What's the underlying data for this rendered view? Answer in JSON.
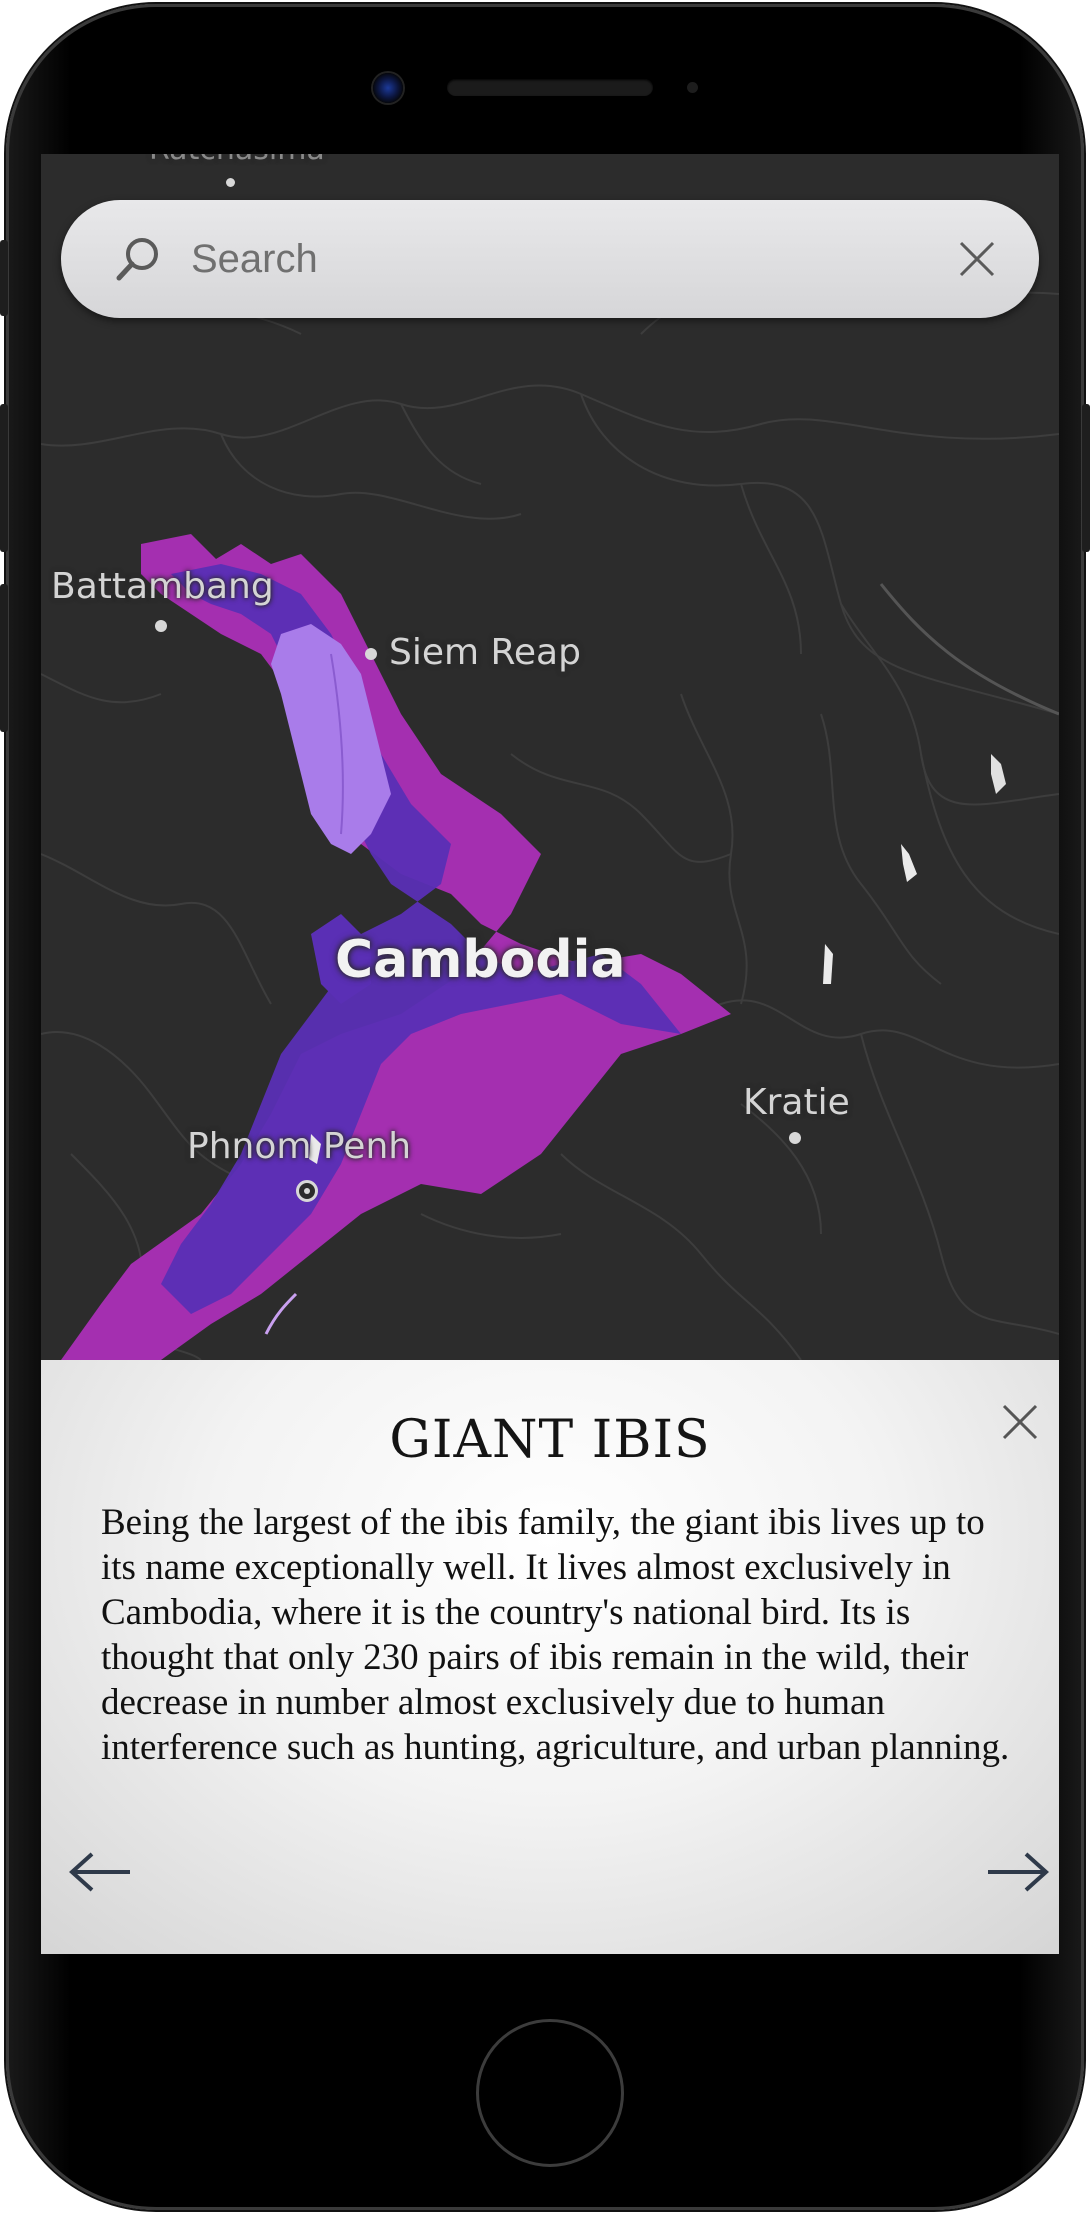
{
  "search": {
    "placeholder": "Search",
    "value": ""
  },
  "map": {
    "labels": {
      "top_cutoff": "Ratchasima",
      "battambang": "Battambang",
      "siem_reap": "Siem Reap",
      "country": "Cambodia",
      "kratie": "Kratie",
      "phnom_penh": "Phnom Penh"
    },
    "colors": {
      "background": "#2c2c2c",
      "range_purple": "#5a2fb5",
      "range_magenta": "#a42fb0",
      "range_lavender": "#a97cea"
    }
  },
  "info_panel": {
    "title": "GIANT IBIS",
    "body": "Being the largest of the ibis family, the giant ibis lives up to its name exceptionally well. It lives almost exclusively in Cambodia, where it is the country's national bird. Its is thought that only 230 pairs of ibis remain in the wild, their decrease in number almost exclusively due to human interference such as hunting, agriculture, and urban planning.",
    "icons": {
      "close": "close-icon",
      "previous": "arrow-left-icon",
      "next": "arrow-right-icon"
    }
  }
}
